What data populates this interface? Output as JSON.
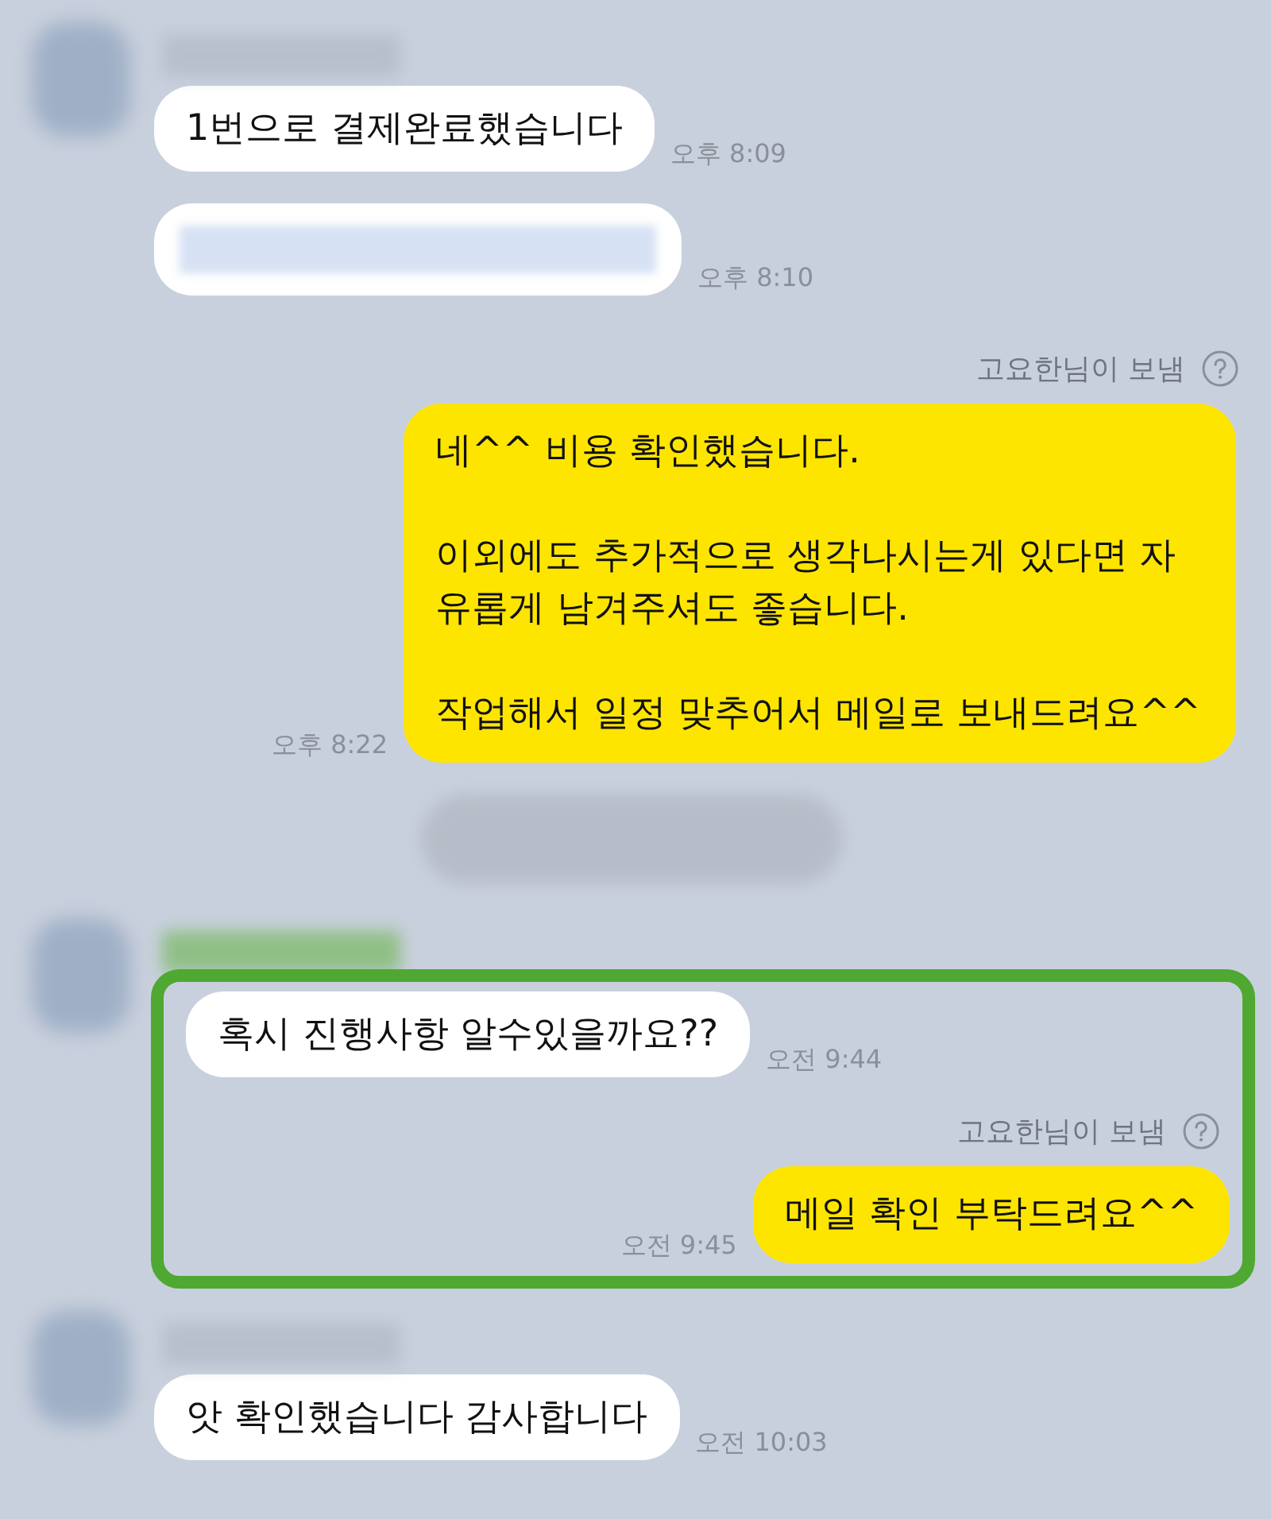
{
  "messages": [
    {
      "kind": "received",
      "show_avatar": true,
      "text": "1번으로 결제완료했습니다",
      "time": "오후 8:09"
    },
    {
      "kind": "redacted",
      "time": "오후 8:10"
    },
    {
      "kind": "sent",
      "sender_note": "고요한님이 보냄",
      "paragraphs": [
        "네^^ 비용 확인했습니다.",
        "이외에도 추가적으로 생각나시는게 있다면 자유롭게 남겨주셔도 좋습니다.",
        "작업해서 일정 맞추어서 메일로 보내드려요^^"
      ],
      "time": "오후 8:22"
    },
    {
      "kind": "notice"
    },
    {
      "kind": "highlight",
      "show_avatar": true,
      "children": [
        {
          "kind": "received",
          "text": "혹시 진행사항 알수있을까요??",
          "time": "오전 9:44"
        },
        {
          "kind": "sent",
          "sender_note": "고요한님이 보냄",
          "paragraphs": [
            "메일 확인 부탁드려요^^"
          ],
          "time": "오전 9:45"
        }
      ]
    },
    {
      "kind": "received",
      "show_avatar": true,
      "text": "앗 확인했습니다 감사합니다",
      "time": "오전 10:03"
    }
  ]
}
